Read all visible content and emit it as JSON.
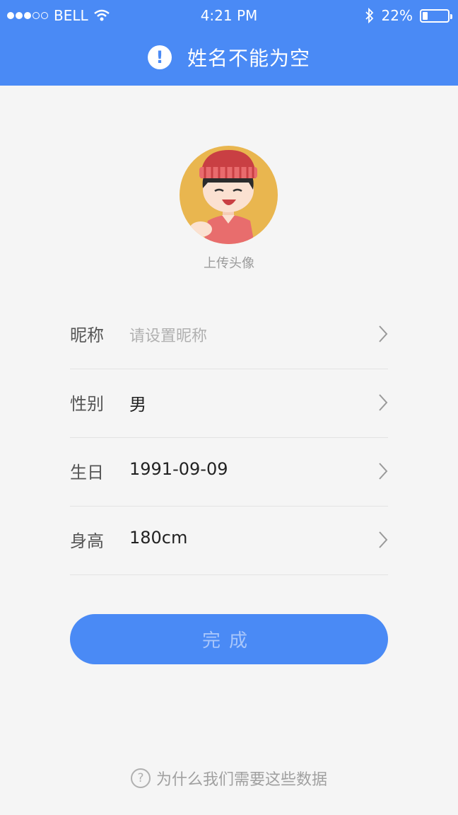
{
  "status_bar": {
    "carrier": "BELL",
    "time": "4:21 PM",
    "battery_text": "22%",
    "battery_level": 0.22
  },
  "alert": {
    "icon": "exclamation-icon",
    "text": "姓名不能为空"
  },
  "avatar": {
    "caption": "上传头像"
  },
  "form": {
    "rows": [
      {
        "label": "昵称",
        "value": "",
        "placeholder": "请设置昵称"
      },
      {
        "label": "性别",
        "value": "男"
      },
      {
        "label": "生日",
        "value": "1991-09-09"
      },
      {
        "label": "身高",
        "value": "180cm"
      }
    ]
  },
  "done_button": {
    "label": "完成"
  },
  "help": {
    "icon": "question-circle-icon",
    "text": "为什么我们需要这些数据"
  },
  "colors": {
    "accent": "#4a8af5",
    "background": "#f5f5f5"
  }
}
